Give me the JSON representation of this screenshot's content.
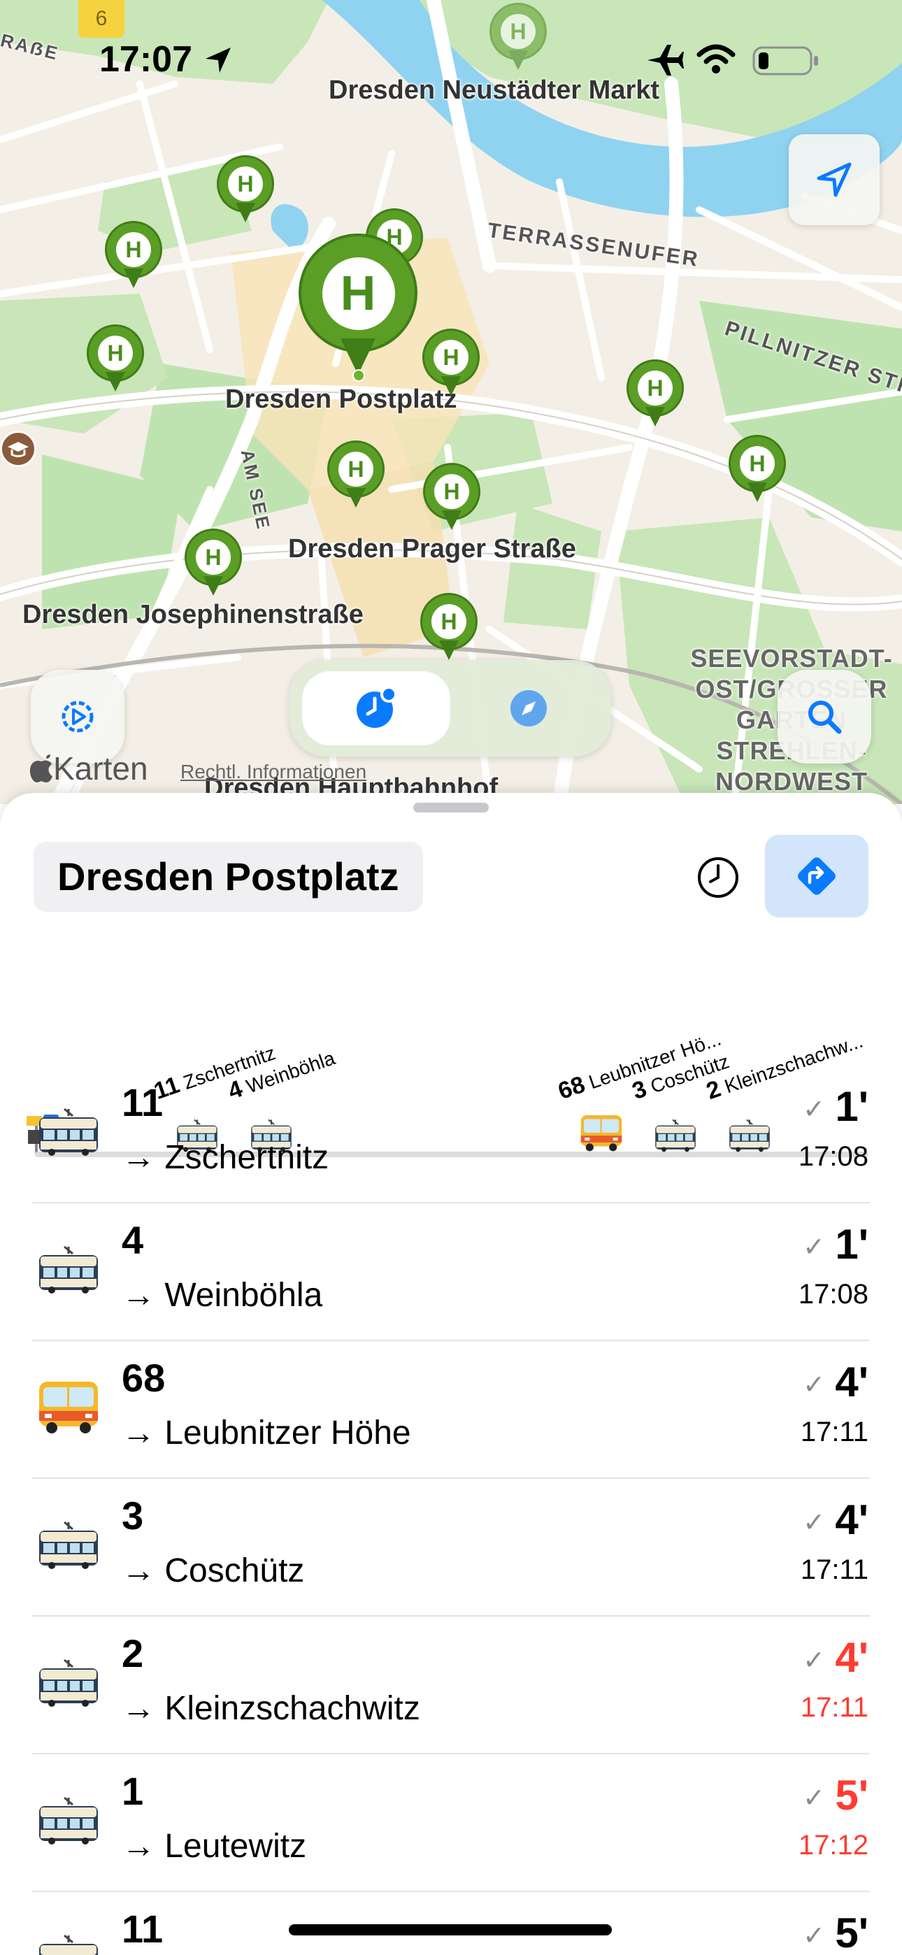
{
  "status_bar": {
    "time": "17:07",
    "calendar_badge": "6"
  },
  "map": {
    "stop_labels": {
      "neustaedter_markt": "Dresden Neustädter Markt",
      "postplatz": "Dresden Postplatz",
      "prager_strasse": "Dresden Prager Straße",
      "josephinenstrasse": "Dresden Josephinenstraße",
      "hauptbahnhof": "Dresden Hauptbahnhof"
    },
    "street_labels": {
      "terrassenufer": "TERRASSENUFER",
      "pillnitzer": "PILLNITZER STRA",
      "am_see": "AM SEE",
      "strasse_top": "RAẞE"
    },
    "area_label": "SEEVORSTADT-\nOST/GROSSER\nGARTEN\nSTREHLEN-\nNORDWEST",
    "pin_letter": "H",
    "brand": "Karten",
    "legal": "Rechtl. Informationen"
  },
  "sheet": {
    "stop_name": "Dresden Postplatz",
    "timeline": [
      {
        "line": "11",
        "dest": "Zschertnitz",
        "vehicle": "tram"
      },
      {
        "line": "4",
        "dest": "Weinböhla",
        "vehicle": "tram"
      },
      {
        "line": "68",
        "dest": "Leubnitzer Hö...",
        "vehicle": "bus"
      },
      {
        "line": "3",
        "dest": "Coschütz",
        "vehicle": "tram"
      },
      {
        "line": "2",
        "dest": "Kleinzschachw...",
        "vehicle": "tram"
      }
    ],
    "departures": [
      {
        "line": "11",
        "dest": "→ Zschertnitz",
        "check": "✓",
        "mins": "1'",
        "time": "17:08",
        "vehicle": "tram-icon",
        "late": false
      },
      {
        "line": "4",
        "dest": "→ Weinböhla",
        "check": "✓",
        "mins": "1'",
        "time": "17:08",
        "vehicle": "tram-icon",
        "late": false
      },
      {
        "line": "68",
        "dest": "→ Leubnitzer Höhe",
        "check": "✓",
        "mins": "4'",
        "time": "17:11",
        "vehicle": "bus-icon",
        "late": false
      },
      {
        "line": "3",
        "dest": "→ Coschütz",
        "check": "✓",
        "mins": "4'",
        "time": "17:11",
        "vehicle": "tram-icon",
        "late": false
      },
      {
        "line": "2",
        "dest": "→ Kleinzschachwitz",
        "check": "✓",
        "mins": "4'",
        "time": "17:11",
        "vehicle": "tram-icon",
        "late": true
      },
      {
        "line": "1",
        "dest": "→ Leutewitz",
        "check": "✓",
        "mins": "5'",
        "time": "17:12",
        "vehicle": "tram-icon",
        "late": true
      },
      {
        "line": "11",
        "dest": "",
        "check": "✓",
        "mins": "5'",
        "time": "",
        "vehicle": "tram-icon",
        "late": false
      }
    ]
  },
  "colors": {
    "stop_pin": "#5a9e26",
    "accent_blue": "#0a7aff",
    "late_red": "#ff3b30",
    "river": "#8fd3f0",
    "park": "#bfe3b0"
  }
}
